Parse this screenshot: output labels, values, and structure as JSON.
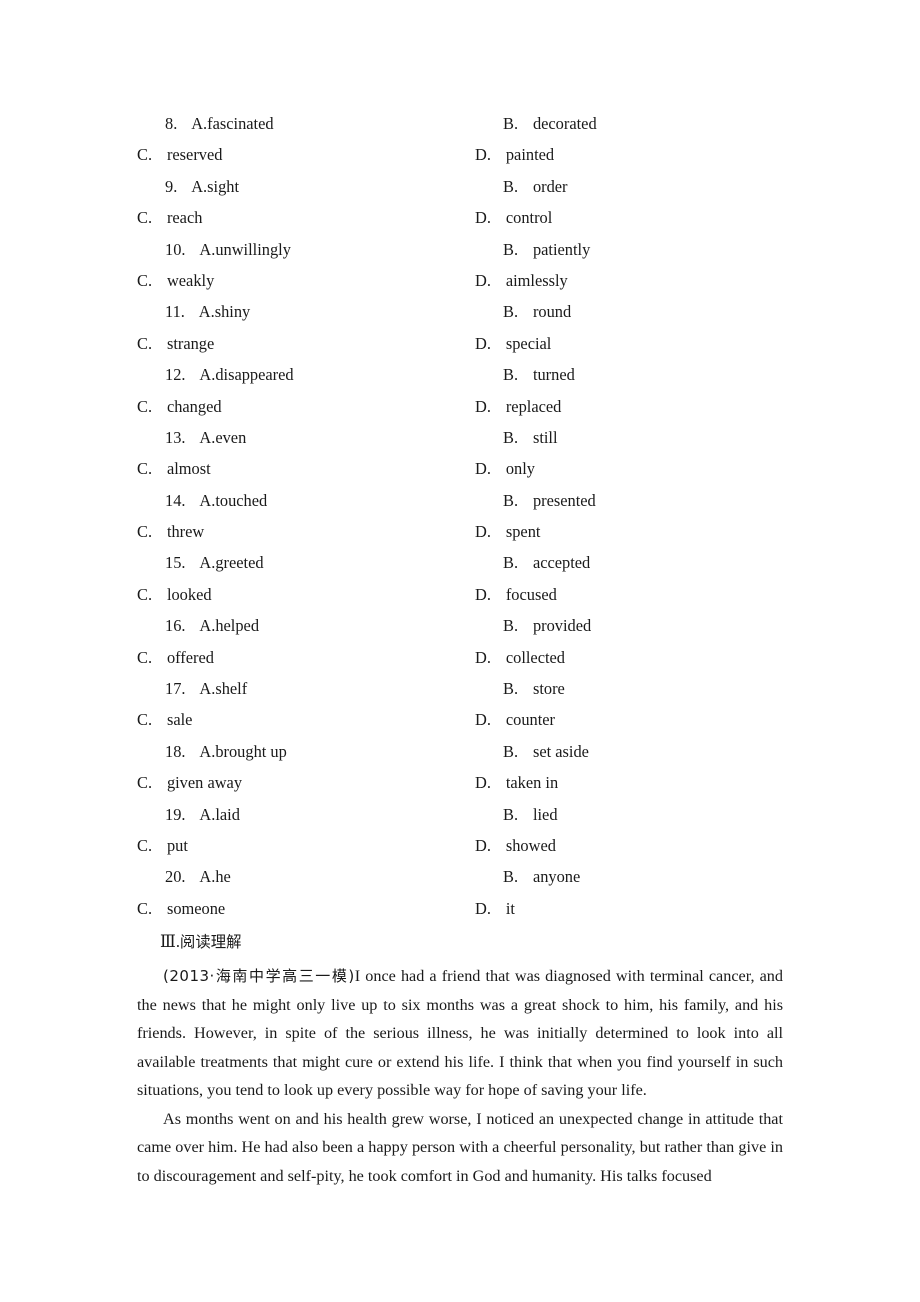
{
  "document": {
    "type": "exam-worksheet",
    "background_color": "#ffffff",
    "text_color": "#1a1a1a"
  },
  "multiple_choice": {
    "items": [
      {
        "number": "8",
        "a_label": "A",
        "a_text": "fascinated",
        "b_label": "B",
        "b_text": "decorated",
        "c_label": "C",
        "c_text": "reserved",
        "d_label": "D",
        "d_text": "painted"
      },
      {
        "number": "9",
        "a_label": "A",
        "a_text": "sight",
        "b_label": "B",
        "b_text": "order",
        "c_label": "C",
        "c_text": "reach",
        "d_label": "D",
        "d_text": "control"
      },
      {
        "number": "10",
        "a_label": "A",
        "a_text": "unwillingly",
        "b_label": "B",
        "b_text": "patiently",
        "c_label": "C",
        "c_text": "weakly",
        "d_label": "D",
        "d_text": "aimlessly"
      },
      {
        "number": "11",
        "a_label": "A",
        "a_text": "shiny",
        "b_label": "B",
        "b_text": "round",
        "c_label": "C",
        "c_text": "strange",
        "d_label": "D",
        "d_text": "special"
      },
      {
        "number": "12",
        "a_label": "A",
        "a_text": "disappeared",
        "b_label": "B",
        "b_text": "turned",
        "c_label": "C",
        "c_text": "changed",
        "d_label": "D",
        "d_text": "replaced"
      },
      {
        "number": "13",
        "a_label": "A",
        "a_text": "even",
        "b_label": "B",
        "b_text": "still",
        "c_label": "C",
        "c_text": "almost",
        "d_label": "D",
        "d_text": "only"
      },
      {
        "number": "14",
        "a_label": "A",
        "a_text": "touched",
        "b_label": "B",
        "b_text": "presented",
        "c_label": "C",
        "c_text": "threw",
        "d_label": "D",
        "d_text": "spent"
      },
      {
        "number": "15",
        "a_label": "A",
        "a_text": "greeted",
        "b_label": "B",
        "b_text": "accepted",
        "c_label": "C",
        "c_text": "looked",
        "d_label": "D",
        "d_text": "focused"
      },
      {
        "number": "16",
        "a_label": "A",
        "a_text": "helped",
        "b_label": "B",
        "b_text": "provided",
        "c_label": "C",
        "c_text": "offered",
        "d_label": "D",
        "d_text": "collected"
      },
      {
        "number": "17",
        "a_label": "A",
        "a_text": "shelf",
        "b_label": "B",
        "b_text": "store",
        "c_label": "C",
        "c_text": "sale",
        "d_label": "D",
        "d_text": "counter"
      },
      {
        "number": "18",
        "a_label": "A",
        "a_text": "brought up",
        "b_label": "B",
        "b_text": "set aside",
        "c_label": "C",
        "c_text": "given away",
        "d_label": "D",
        "d_text": "taken in"
      },
      {
        "number": "19",
        "a_label": "A",
        "a_text": "laid",
        "b_label": "B",
        "b_text": "lied",
        "c_label": "C",
        "c_text": "put",
        "d_label": "D",
        "d_text": "showed"
      },
      {
        "number": "20",
        "a_label": "A",
        "a_text": "he",
        "b_label": "B",
        "b_text": "anyone",
        "c_label": "C",
        "c_text": "someone",
        "d_label": "D",
        "d_text": "it"
      }
    ]
  },
  "reading_section": {
    "heading_numeral": "Ⅲ",
    "heading_separator": ".",
    "heading_title": "阅读理解",
    "source_citation": "(2013·海南中学高三一模)",
    "paragraph_1_rest": "I once had a friend that was diagnosed with terminal cancer, and the news that he might only live up to six months was a great shock to him, his family, and his friends. However, in spite of the serious illness, he was initially determined to look into all available treatments that might cure or extend his life. I think that when you find yourself in such situations, you tend to look up every possible way for hope of saving your life.",
    "paragraph_2": "As months went on and his health grew worse, I noticed an unexpected change in attitude that came over him. He had also been a happy person with a cheerful personality, but rather than give in to discouragement and self-pity, he took comfort in God and humanity. His talks focused"
  }
}
